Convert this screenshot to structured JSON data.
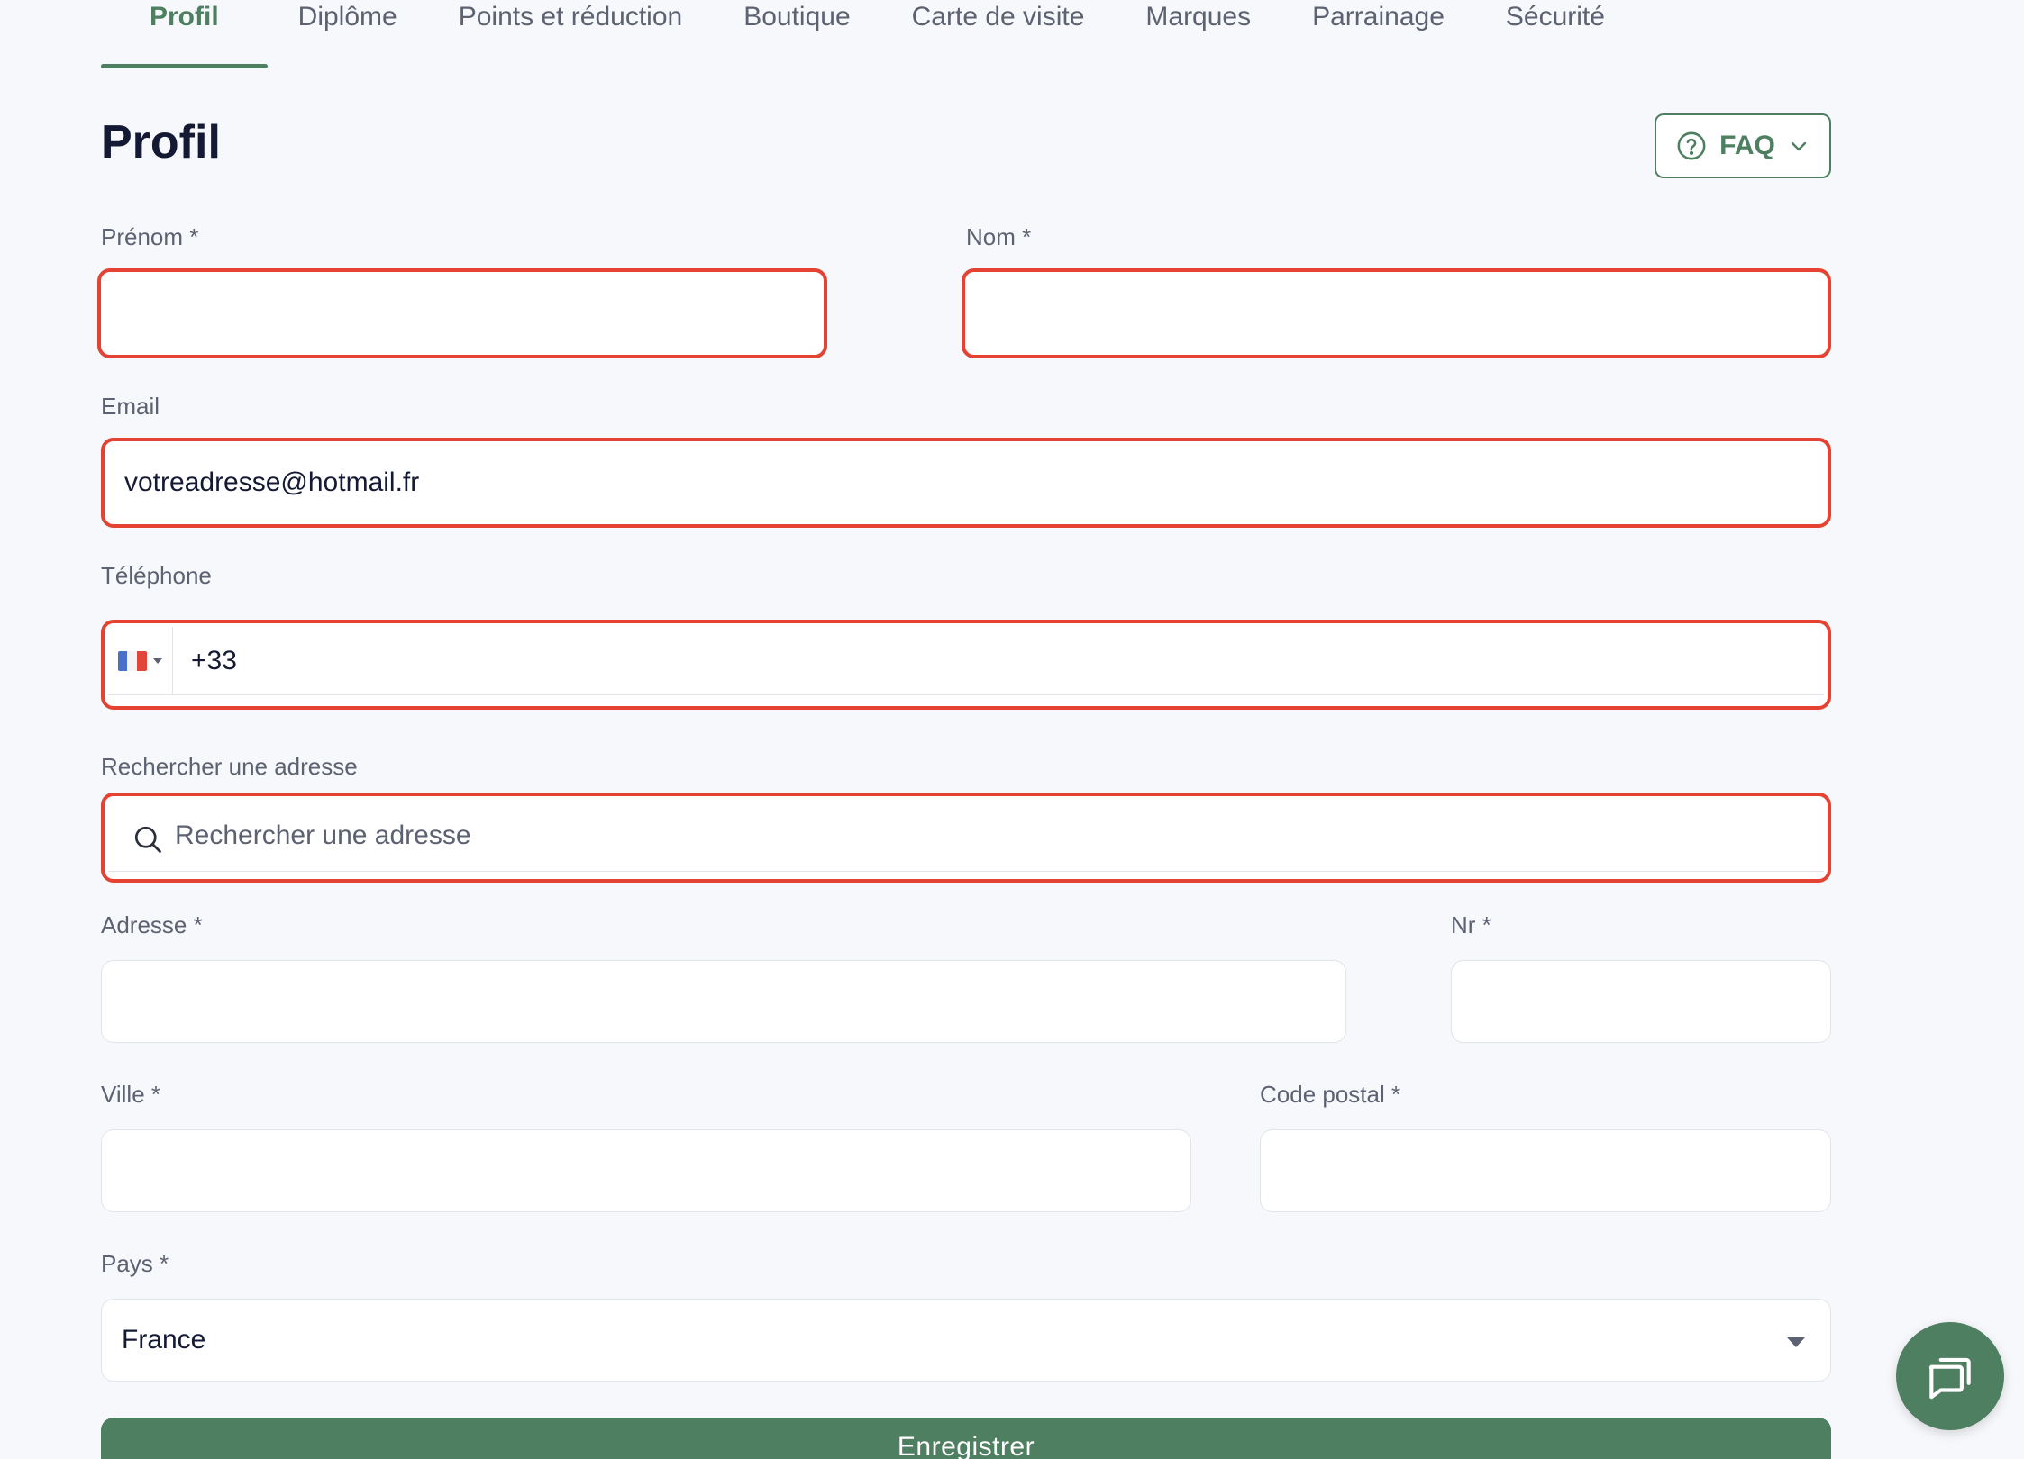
{
  "tabs": [
    {
      "label": "Profil",
      "active": true
    },
    {
      "label": "Diplôme"
    },
    {
      "label": "Points et réduction"
    },
    {
      "label": "Boutique"
    },
    {
      "label": "Carte de visite"
    },
    {
      "label": "Marques"
    },
    {
      "label": "Parrainage"
    },
    {
      "label": "Sécurité"
    }
  ],
  "page": {
    "title": "Profil",
    "faq_label": "FAQ"
  },
  "form": {
    "prenom": {
      "label": "Prénom *",
      "value": ""
    },
    "nom": {
      "label": "Nom *",
      "value": ""
    },
    "email": {
      "label": "Email",
      "value": "votreadresse@hotmail.fr"
    },
    "telephone": {
      "label": "Téléphone",
      "value": "+33",
      "country": "France"
    },
    "search_address": {
      "label": "Rechercher une adresse",
      "placeholder": "Rechercher une adresse"
    },
    "adresse": {
      "label": "Adresse *",
      "value": ""
    },
    "nr": {
      "label": "Nr *",
      "value": ""
    },
    "ville": {
      "label": "Ville *",
      "value": ""
    },
    "code_postal": {
      "label": "Code postal *",
      "value": ""
    },
    "pays": {
      "label": "Pays *",
      "value": "France"
    },
    "submit_label": "Enregistrer"
  },
  "colors": {
    "brand": "#4f7f61",
    "error": "#e44232",
    "title": "#141a33"
  },
  "icons": {
    "faq": "help-circle-icon",
    "faq_toggle": "chevron-down-icon",
    "search": "search-icon",
    "chat": "chat-icon"
  }
}
